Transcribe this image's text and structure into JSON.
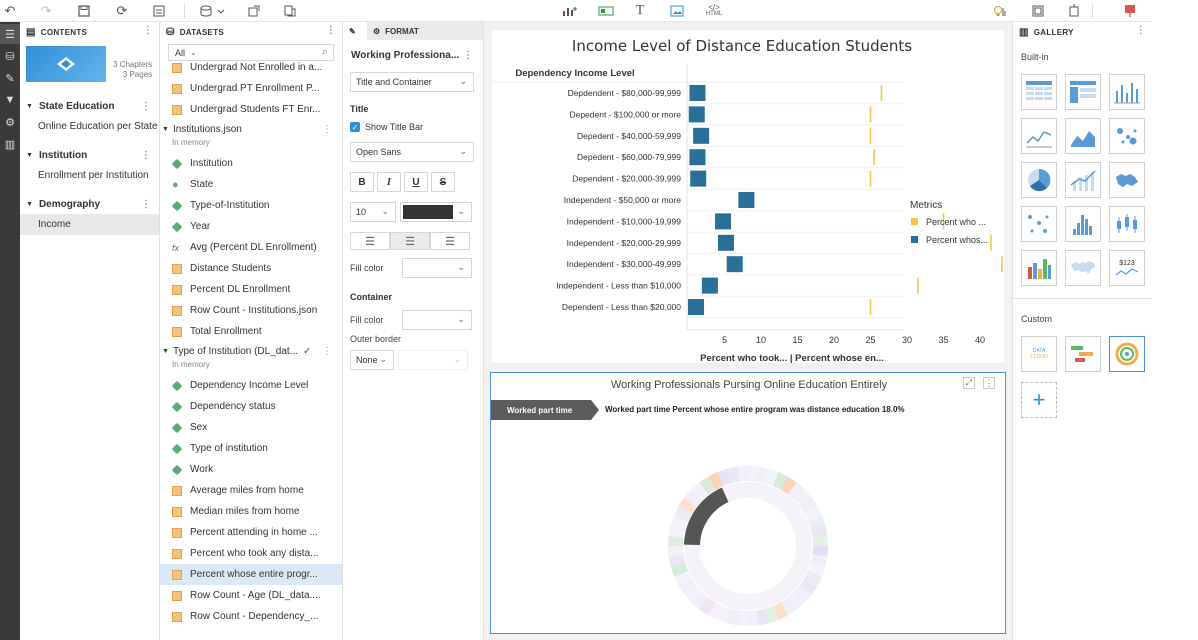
{
  "toolbar": {
    "icons": [
      "undo-icon",
      "redo-icon",
      "save-icon",
      "refresh-icon",
      "save-as-icon",
      "add-data-icon",
      "export-icon",
      "duplicate-icon",
      "insert-visualization-icon",
      "insert-filter-icon",
      "insert-text-icon",
      "insert-image-icon",
      "insert-html-icon",
      "tips-icon",
      "layout-icon",
      "share-icon",
      "present-icon"
    ]
  },
  "contents": {
    "header": "CONTENTS",
    "chapters_count": "3 Chapters",
    "pages_count": "3 Pages",
    "chapters": [
      {
        "label": "State Education",
        "pages": [
          "Online Education per State"
        ]
      },
      {
        "label": "Institution",
        "pages": [
          "Enrollment per Institution"
        ]
      },
      {
        "label": "Demography",
        "pages": [
          "Income"
        ]
      }
    ]
  },
  "datasets": {
    "header": "DATASETS",
    "filter_value": "All",
    "items_top": [
      {
        "label": "Undergrad Not Enrolled in a...",
        "type": "measure"
      },
      {
        "label": "Undergrad PT Enrollment P...",
        "type": "measure"
      },
      {
        "label": "Undergrad Students FT Enr...",
        "type": "measure"
      }
    ],
    "group1": {
      "label": "Institutions.json",
      "sub": "In memory"
    },
    "items_group1": [
      {
        "label": "Institution",
        "type": "dimension"
      },
      {
        "label": "State",
        "type": "geo"
      },
      {
        "label": "Type-of-Institution",
        "type": "dimension"
      },
      {
        "label": "Year",
        "type": "dimension"
      },
      {
        "label": "Avg (Percent DL Enrollment)",
        "type": "fx"
      },
      {
        "label": "Distance Students",
        "type": "measure"
      },
      {
        "label": "Percent DL Enrollment",
        "type": "measure"
      },
      {
        "label": "Row Count - Institutions.json",
        "type": "measure"
      },
      {
        "label": "Total Enrollment",
        "type": "measure"
      }
    ],
    "group2": {
      "label": "Type of Institution (DL_dat...",
      "sub": "In memory"
    },
    "items_group2": [
      {
        "label": "Dependency Income Level",
        "type": "dimension"
      },
      {
        "label": "Dependency status",
        "type": "dimension"
      },
      {
        "label": "Sex",
        "type": "dimension"
      },
      {
        "label": "Type of institution",
        "type": "dimension"
      },
      {
        "label": "Work",
        "type": "dimension"
      },
      {
        "label": "Average miles from home",
        "type": "measure"
      },
      {
        "label": "Median miles from home",
        "type": "measure"
      },
      {
        "label": "Percent attending in home ...",
        "type": "measure"
      },
      {
        "label": "Percent who took any dista...",
        "type": "measure"
      },
      {
        "label": "Percent whose entire progr...",
        "type": "measure"
      },
      {
        "label": "Row Count - Age (DL_data....",
        "type": "measure"
      },
      {
        "label": "Row Count - Dependency_...",
        "type": "measure"
      }
    ]
  },
  "format": {
    "tab_label": "FORMAT",
    "viz_name": "Working Professiona...",
    "element_select": "Title and Container",
    "title_section": "Title",
    "show_title_bar": "Show Title Bar",
    "font_family": "Open Sans",
    "style_buttons": [
      "B",
      "I",
      "U",
      "S"
    ],
    "font_size": "10",
    "fill_color_label": "Fill color",
    "container_section": "Container",
    "container_fill_label": "Fill color",
    "outer_border_label": "Outer border",
    "outer_border_value": "None",
    "font_color": "#333333"
  },
  "chart1": {
    "title": "Income Level of Distance Education Students",
    "column_header": "Dependency Income Level",
    "legend_title": "Metrics",
    "axis_label": "Percent who took...  |  Percent whose en...",
    "colors": {
      "percent_who_took": "#f8c34a",
      "percent_whose_entire": "#2a6f97"
    }
  },
  "chart_data": [
    {
      "type": "scatter",
      "title": "Income Level of Distance Education Students",
      "xlabel": "Percent who took...  |  Percent whose en...",
      "ylabel": "Dependency Income Level",
      "xlim": [
        0,
        50
      ],
      "xticks": [
        5,
        10,
        15,
        20,
        25,
        30,
        35,
        40,
        45
      ],
      "categories": [
        "Depdendent - $80,000-99,999",
        "Depedent - $100,000 or more",
        "Depedent - $40,000-59,999",
        "Depedent - $60,000-79,999",
        "Dependent - $20,000-39,999",
        "Independent -  $50,000 or more",
        "Independent - $10,000-19,999",
        "Independent - $20,000-29,999",
        "Independent - $30,000-49,999",
        "Independent - Less than $10,000",
        "Dependent - Less than $20,000"
      ],
      "series": [
        {
          "name": "Percent who ...",
          "marker": "line",
          "values": [
            26.5,
            25.0,
            25.0,
            25.5,
            25.0,
            45.0,
            35.0,
            41.5,
            43.0,
            31.5,
            25.0
          ]
        },
        {
          "name": "Percent whos...",
          "marker": "square",
          "values": [
            1.3,
            1.2,
            1.8,
            1.3,
            1.4,
            8.0,
            4.8,
            5.2,
            6.4,
            3.0,
            1.1
          ]
        }
      ],
      "legend": "right"
    }
  ],
  "chart2": {
    "title": "Working Professionals Pursing Online Education Entirely",
    "tag": "Worked part time",
    "caption": "Worked part time Percent whose entire program was distance education 18.0%",
    "highlight_percent": 18.0,
    "colors": {
      "highlight": "#555555"
    }
  },
  "gallery": {
    "header": "GALLERY",
    "builtin_label": "Built-in",
    "custom_label": "Custom",
    "builtin": [
      "grid-icon",
      "crosstab-icon",
      "bar-chart-icon",
      "line-chart-icon",
      "area-chart-icon",
      "bubble-chart-icon",
      "pie-chart-icon",
      "combo-chart-icon",
      "map-icon",
      "network-icon",
      "histogram-icon",
      "box-plot-icon",
      "heatmap-icon",
      "world-map-icon",
      "kpi-icon"
    ],
    "kpi_text": "$123",
    "custom": [
      "data-cloud-icon",
      "gantt-icon",
      "radial-icon"
    ],
    "add": "add-visualization-icon"
  }
}
